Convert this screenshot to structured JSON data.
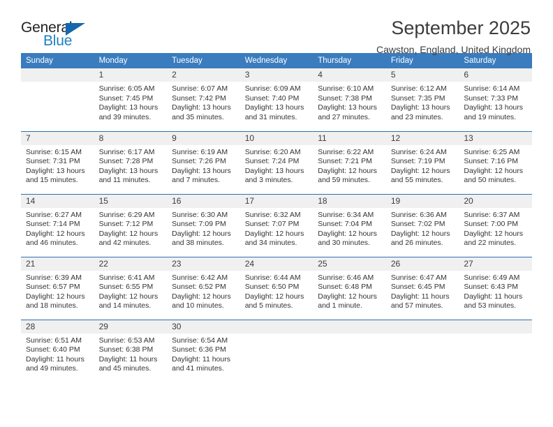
{
  "brand": {
    "name_top": "General",
    "name_bottom": "Blue",
    "triangle_color": "#1467ae",
    "blue_color": "#1f7fc4"
  },
  "header": {
    "month_title": "September 2025",
    "location": "Cawston, England, United Kingdom"
  },
  "theme": {
    "header_blue": "#3a7cbe",
    "band_gray": "#f0f0f0",
    "grid_line": "#2f6fae"
  },
  "weekday_headers": [
    "Sunday",
    "Monday",
    "Tuesday",
    "Wednesday",
    "Thursday",
    "Friday",
    "Saturday"
  ],
  "weeks": [
    [
      {
        "day": "",
        "sunrise": "",
        "sunset": "",
        "daylight_line1": "",
        "daylight_line2": "",
        "empty": true
      },
      {
        "day": "1",
        "sunrise": "Sunrise: 6:05 AM",
        "sunset": "Sunset: 7:45 PM",
        "daylight_line1": "Daylight: 13 hours",
        "daylight_line2": "and 39 minutes."
      },
      {
        "day": "2",
        "sunrise": "Sunrise: 6:07 AM",
        "sunset": "Sunset: 7:42 PM",
        "daylight_line1": "Daylight: 13 hours",
        "daylight_line2": "and 35 minutes."
      },
      {
        "day": "3",
        "sunrise": "Sunrise: 6:09 AM",
        "sunset": "Sunset: 7:40 PM",
        "daylight_line1": "Daylight: 13 hours",
        "daylight_line2": "and 31 minutes."
      },
      {
        "day": "4",
        "sunrise": "Sunrise: 6:10 AM",
        "sunset": "Sunset: 7:38 PM",
        "daylight_line1": "Daylight: 13 hours",
        "daylight_line2": "and 27 minutes."
      },
      {
        "day": "5",
        "sunrise": "Sunrise: 6:12 AM",
        "sunset": "Sunset: 7:35 PM",
        "daylight_line1": "Daylight: 13 hours",
        "daylight_line2": "and 23 minutes."
      },
      {
        "day": "6",
        "sunrise": "Sunrise: 6:14 AM",
        "sunset": "Sunset: 7:33 PM",
        "daylight_line1": "Daylight: 13 hours",
        "daylight_line2": "and 19 minutes."
      }
    ],
    [
      {
        "day": "7",
        "sunrise": "Sunrise: 6:15 AM",
        "sunset": "Sunset: 7:31 PM",
        "daylight_line1": "Daylight: 13 hours",
        "daylight_line2": "and 15 minutes."
      },
      {
        "day": "8",
        "sunrise": "Sunrise: 6:17 AM",
        "sunset": "Sunset: 7:28 PM",
        "daylight_line1": "Daylight: 13 hours",
        "daylight_line2": "and 11 minutes."
      },
      {
        "day": "9",
        "sunrise": "Sunrise: 6:19 AM",
        "sunset": "Sunset: 7:26 PM",
        "daylight_line1": "Daylight: 13 hours",
        "daylight_line2": "and 7 minutes."
      },
      {
        "day": "10",
        "sunrise": "Sunrise: 6:20 AM",
        "sunset": "Sunset: 7:24 PM",
        "daylight_line1": "Daylight: 13 hours",
        "daylight_line2": "and 3 minutes."
      },
      {
        "day": "11",
        "sunrise": "Sunrise: 6:22 AM",
        "sunset": "Sunset: 7:21 PM",
        "daylight_line1": "Daylight: 12 hours",
        "daylight_line2": "and 59 minutes."
      },
      {
        "day": "12",
        "sunrise": "Sunrise: 6:24 AM",
        "sunset": "Sunset: 7:19 PM",
        "daylight_line1": "Daylight: 12 hours",
        "daylight_line2": "and 55 minutes."
      },
      {
        "day": "13",
        "sunrise": "Sunrise: 6:25 AM",
        "sunset": "Sunset: 7:16 PM",
        "daylight_line1": "Daylight: 12 hours",
        "daylight_line2": "and 50 minutes."
      }
    ],
    [
      {
        "day": "14",
        "sunrise": "Sunrise: 6:27 AM",
        "sunset": "Sunset: 7:14 PM",
        "daylight_line1": "Daylight: 12 hours",
        "daylight_line2": "and 46 minutes."
      },
      {
        "day": "15",
        "sunrise": "Sunrise: 6:29 AM",
        "sunset": "Sunset: 7:12 PM",
        "daylight_line1": "Daylight: 12 hours",
        "daylight_line2": "and 42 minutes."
      },
      {
        "day": "16",
        "sunrise": "Sunrise: 6:30 AM",
        "sunset": "Sunset: 7:09 PM",
        "daylight_line1": "Daylight: 12 hours",
        "daylight_line2": "and 38 minutes."
      },
      {
        "day": "17",
        "sunrise": "Sunrise: 6:32 AM",
        "sunset": "Sunset: 7:07 PM",
        "daylight_line1": "Daylight: 12 hours",
        "daylight_line2": "and 34 minutes."
      },
      {
        "day": "18",
        "sunrise": "Sunrise: 6:34 AM",
        "sunset": "Sunset: 7:04 PM",
        "daylight_line1": "Daylight: 12 hours",
        "daylight_line2": "and 30 minutes."
      },
      {
        "day": "19",
        "sunrise": "Sunrise: 6:36 AM",
        "sunset": "Sunset: 7:02 PM",
        "daylight_line1": "Daylight: 12 hours",
        "daylight_line2": "and 26 minutes."
      },
      {
        "day": "20",
        "sunrise": "Sunrise: 6:37 AM",
        "sunset": "Sunset: 7:00 PM",
        "daylight_line1": "Daylight: 12 hours",
        "daylight_line2": "and 22 minutes."
      }
    ],
    [
      {
        "day": "21",
        "sunrise": "Sunrise: 6:39 AM",
        "sunset": "Sunset: 6:57 PM",
        "daylight_line1": "Daylight: 12 hours",
        "daylight_line2": "and 18 minutes."
      },
      {
        "day": "22",
        "sunrise": "Sunrise: 6:41 AM",
        "sunset": "Sunset: 6:55 PM",
        "daylight_line1": "Daylight: 12 hours",
        "daylight_line2": "and 14 minutes."
      },
      {
        "day": "23",
        "sunrise": "Sunrise: 6:42 AM",
        "sunset": "Sunset: 6:52 PM",
        "daylight_line1": "Daylight: 12 hours",
        "daylight_line2": "and 10 minutes."
      },
      {
        "day": "24",
        "sunrise": "Sunrise: 6:44 AM",
        "sunset": "Sunset: 6:50 PM",
        "daylight_line1": "Daylight: 12 hours",
        "daylight_line2": "and 5 minutes."
      },
      {
        "day": "25",
        "sunrise": "Sunrise: 6:46 AM",
        "sunset": "Sunset: 6:48 PM",
        "daylight_line1": "Daylight: 12 hours",
        "daylight_line2": "and 1 minute."
      },
      {
        "day": "26",
        "sunrise": "Sunrise: 6:47 AM",
        "sunset": "Sunset: 6:45 PM",
        "daylight_line1": "Daylight: 11 hours",
        "daylight_line2": "and 57 minutes."
      },
      {
        "day": "27",
        "sunrise": "Sunrise: 6:49 AM",
        "sunset": "Sunset: 6:43 PM",
        "daylight_line1": "Daylight: 11 hours",
        "daylight_line2": "and 53 minutes."
      }
    ],
    [
      {
        "day": "28",
        "sunrise": "Sunrise: 6:51 AM",
        "sunset": "Sunset: 6:40 PM",
        "daylight_line1": "Daylight: 11 hours",
        "daylight_line2": "and 49 minutes."
      },
      {
        "day": "29",
        "sunrise": "Sunrise: 6:53 AM",
        "sunset": "Sunset: 6:38 PM",
        "daylight_line1": "Daylight: 11 hours",
        "daylight_line2": "and 45 minutes."
      },
      {
        "day": "30",
        "sunrise": "Sunrise: 6:54 AM",
        "sunset": "Sunset: 6:36 PM",
        "daylight_line1": "Daylight: 11 hours",
        "daylight_line2": "and 41 minutes."
      },
      {
        "day": "",
        "sunrise": "",
        "sunset": "",
        "daylight_line1": "",
        "daylight_line2": "",
        "empty": true
      },
      {
        "day": "",
        "sunrise": "",
        "sunset": "",
        "daylight_line1": "",
        "daylight_line2": "",
        "empty": true
      },
      {
        "day": "",
        "sunrise": "",
        "sunset": "",
        "daylight_line1": "",
        "daylight_line2": "",
        "empty": true
      },
      {
        "day": "",
        "sunrise": "",
        "sunset": "",
        "daylight_line1": "",
        "daylight_line2": "",
        "empty": true
      }
    ]
  ]
}
